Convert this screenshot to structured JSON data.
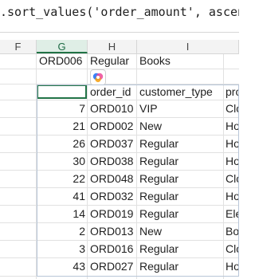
{
  "formula_bar": {
    "text": ".sort_values('order_amount', ascending"
  },
  "column_headers": [
    "F",
    "G",
    "H",
    "I"
  ],
  "selected_column": "G",
  "row_top": {
    "g": "ORD006",
    "h": "Regular",
    "i": "Books"
  },
  "table": {
    "headers": [
      "",
      "order_id",
      "customer_type",
      "pro"
    ],
    "rows": [
      [
        "7",
        "ORD010",
        "VIP",
        "Clo"
      ],
      [
        "21",
        "ORD002",
        "New",
        "Ho"
      ],
      [
        "26",
        "ORD037",
        "Regular",
        "Ho"
      ],
      [
        "30",
        "ORD038",
        "Regular",
        "Ho"
      ],
      [
        "22",
        "ORD048",
        "Regular",
        "Clo"
      ],
      [
        "41",
        "ORD032",
        "Regular",
        "Ho"
      ],
      [
        "14",
        "ORD019",
        "Regular",
        "Ele"
      ],
      [
        "2",
        "ORD013",
        "New",
        "Boo"
      ],
      [
        "3",
        "ORD016",
        "Regular",
        "Clo"
      ],
      [
        "43",
        "ORD027",
        "Regular",
        "Ho"
      ]
    ]
  },
  "colors": {
    "accent": "#217346",
    "selected_header_bg": "#dfeee6",
    "gridline": "#e1e1e1",
    "range_outline": "#b8c6d8"
  },
  "icons": {
    "copilot": "copilot-icon"
  }
}
